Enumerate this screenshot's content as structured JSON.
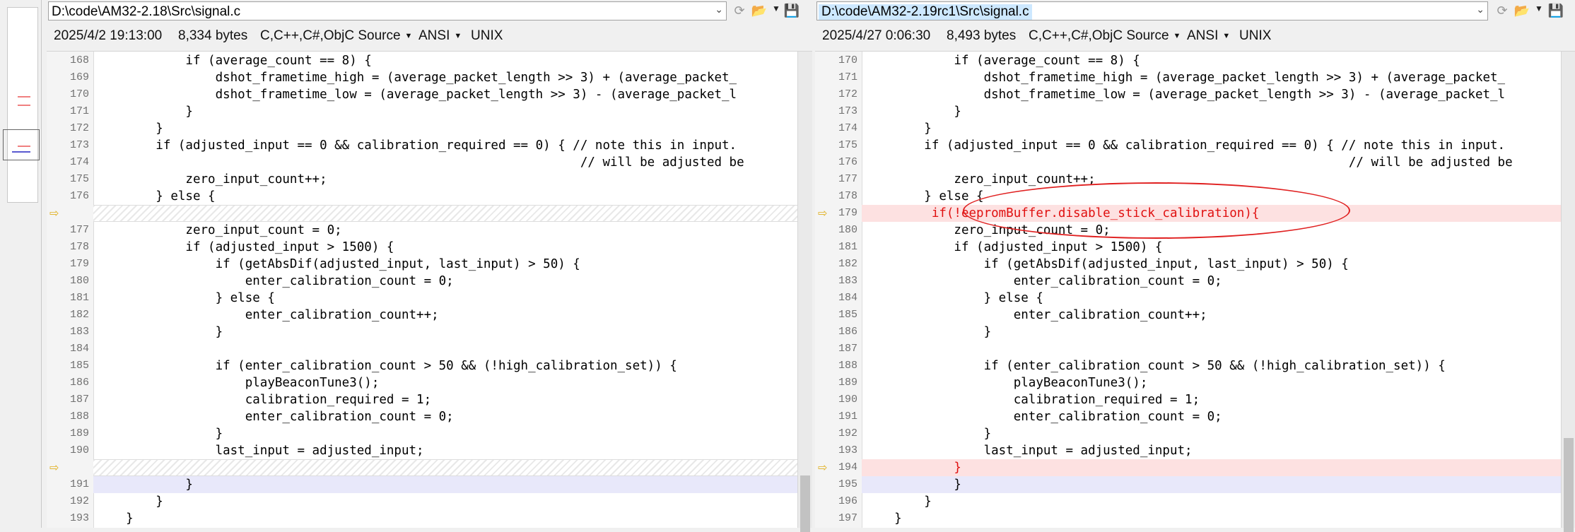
{
  "left": {
    "path": "D:\\code\\AM32-2.18\\Src\\signal.c",
    "date": "2025/4/2 19:13:00",
    "size": "8,334 bytes",
    "filetype": "C,C++,C#,ObjC Source",
    "encoding": "ANSI",
    "lineending": "UNIX",
    "lines": [
      {
        "n": "168",
        "text": "            if (average_count == 8) {",
        "kind": "normal"
      },
      {
        "n": "169",
        "text": "                dshot_frametime_high = (average_packet_length >> 3) + (average_packet_",
        "kind": "normal"
      },
      {
        "n": "170",
        "text": "                dshot_frametime_low = (average_packet_length >> 3) - (average_packet_l",
        "kind": "normal"
      },
      {
        "n": "171",
        "text": "            }",
        "kind": "normal"
      },
      {
        "n": "172",
        "text": "        }",
        "kind": "normal"
      },
      {
        "n": "173",
        "text": "        if (adjusted_input == 0 && calibration_required == 0) { // note this in input.",
        "kind": "normal"
      },
      {
        "n": "174",
        "text": "                                                                 // will be adjusted be",
        "kind": "normal"
      },
      {
        "n": "175",
        "text": "            zero_input_count++;",
        "kind": "normal"
      },
      {
        "n": "176",
        "text": "        } else {",
        "kind": "normal"
      },
      {
        "n": "",
        "text": "",
        "kind": "blank"
      },
      {
        "n": "177",
        "text": "            zero_input_count = 0;",
        "kind": "normal"
      },
      {
        "n": "178",
        "text": "            if (adjusted_input > 1500) {",
        "kind": "normal"
      },
      {
        "n": "179",
        "text": "                if (getAbsDif(adjusted_input, last_input) > 50) {",
        "kind": "normal"
      },
      {
        "n": "180",
        "text": "                    enter_calibration_count = 0;",
        "kind": "normal"
      },
      {
        "n": "181",
        "text": "                } else {",
        "kind": "normal"
      },
      {
        "n": "182",
        "text": "                    enter_calibration_count++;",
        "kind": "normal"
      },
      {
        "n": "183",
        "text": "                }",
        "kind": "normal"
      },
      {
        "n": "184",
        "text": "",
        "kind": "normal"
      },
      {
        "n": "185",
        "text": "                if (enter_calibration_count > 50 && (!high_calibration_set)) {",
        "kind": "normal"
      },
      {
        "n": "186",
        "text": "                    playBeaconTune3();",
        "kind": "normal"
      },
      {
        "n": "187",
        "text": "                    calibration_required = 1;",
        "kind": "normal"
      },
      {
        "n": "188",
        "text": "                    enter_calibration_count = 0;",
        "kind": "normal"
      },
      {
        "n": "189",
        "text": "                }",
        "kind": "normal"
      },
      {
        "n": "190",
        "text": "                last_input = adjusted_input;",
        "kind": "normal"
      },
      {
        "n": "",
        "text": "",
        "kind": "blank"
      },
      {
        "n": "191",
        "text": "            }",
        "kind": "moved"
      },
      {
        "n": "192",
        "text": "        }",
        "kind": "normal"
      },
      {
        "n": "193",
        "text": "    }",
        "kind": "normal"
      }
    ]
  },
  "right": {
    "path": "D:\\code\\AM32-2.19rc1\\Src\\signal.c",
    "date": "2025/4/27 0:06:30",
    "size": "8,493 bytes",
    "filetype": "C,C++,C#,ObjC Source",
    "encoding": "ANSI",
    "lineending": "UNIX",
    "lines": [
      {
        "n": "170",
        "text": "            if (average_count == 8) {",
        "kind": "normal"
      },
      {
        "n": "171",
        "text": "                dshot_frametime_high = (average_packet_length >> 3) + (average_packet_",
        "kind": "normal"
      },
      {
        "n": "172",
        "text": "                dshot_frametime_low = (average_packet_length >> 3) - (average_packet_l",
        "kind": "normal"
      },
      {
        "n": "173",
        "text": "            }",
        "kind": "normal"
      },
      {
        "n": "174",
        "text": "        }",
        "kind": "normal"
      },
      {
        "n": "175",
        "text": "        if (adjusted_input == 0 && calibration_required == 0) { // note this in input.",
        "kind": "normal"
      },
      {
        "n": "176",
        "text": "                                                                 // will be adjusted be",
        "kind": "normal"
      },
      {
        "n": "177",
        "text": "            zero_input_count++;",
        "kind": "normal"
      },
      {
        "n": "178",
        "text": "        } else {",
        "kind": "normal"
      },
      {
        "n": "179",
        "text": "         if(!eepromBuffer.disable_stick_calibration){",
        "kind": "changed"
      },
      {
        "n": "180",
        "text": "            zero_input_count = 0;",
        "kind": "normal"
      },
      {
        "n": "181",
        "text": "            if (adjusted_input > 1500) {",
        "kind": "normal"
      },
      {
        "n": "182",
        "text": "                if (getAbsDif(adjusted_input, last_input) > 50) {",
        "kind": "normal"
      },
      {
        "n": "183",
        "text": "                    enter_calibration_count = 0;",
        "kind": "normal"
      },
      {
        "n": "184",
        "text": "                } else {",
        "kind": "normal"
      },
      {
        "n": "185",
        "text": "                    enter_calibration_count++;",
        "kind": "normal"
      },
      {
        "n": "186",
        "text": "                }",
        "kind": "normal"
      },
      {
        "n": "187",
        "text": "",
        "kind": "normal"
      },
      {
        "n": "188",
        "text": "                if (enter_calibration_count > 50 && (!high_calibration_set)) {",
        "kind": "normal"
      },
      {
        "n": "189",
        "text": "                    playBeaconTune3();",
        "kind": "normal"
      },
      {
        "n": "190",
        "text": "                    calibration_required = 1;",
        "kind": "normal"
      },
      {
        "n": "191",
        "text": "                    enter_calibration_count = 0;",
        "kind": "normal"
      },
      {
        "n": "192",
        "text": "                }",
        "kind": "normal"
      },
      {
        "n": "193",
        "text": "                last_input = adjusted_input;",
        "kind": "normal"
      },
      {
        "n": "194",
        "text": "            }",
        "kind": "changed"
      },
      {
        "n": "195",
        "text": "            }",
        "kind": "moved"
      },
      {
        "n": "196",
        "text": "        }",
        "kind": "normal"
      },
      {
        "n": "197",
        "text": "    }",
        "kind": "normal"
      }
    ]
  },
  "icons": {
    "combo": "chevron-down-icon",
    "refresh": "refresh-icon",
    "open": "folder-icon",
    "save": "save-icon",
    "diffmark": "arrow-right-icon"
  },
  "colors": {
    "changed_bg": "#fde1e1",
    "changed_text": "#e01010",
    "moved_bg": "#e8e8fa",
    "annotation": "#e02020"
  }
}
